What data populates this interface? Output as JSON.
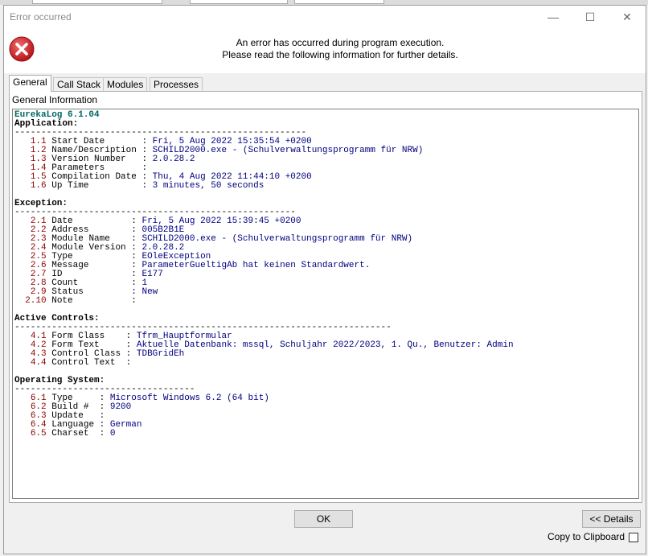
{
  "window": {
    "title": "Error occurred",
    "minimize_glyph": "—",
    "maximize_glyph": "☐",
    "close_glyph": "✕"
  },
  "header": {
    "line1": "An error has occurred during program execution.",
    "line2": "Please read the following information for further details.",
    "icon": "error-icon",
    "icon_color": "#d8262b"
  },
  "tabs": [
    "General",
    "Call Stack",
    "Modules",
    "Processes"
  ],
  "panel": {
    "title": "General Information"
  },
  "report": {
    "header": "EurekaLog 6.1.04",
    "sections": [
      {
        "title": "Application:",
        "rule": "-------------------------------------------------------",
        "rows": [
          {
            "n": "1.1",
            "label": "Start Date      ",
            "value": "Fri, 5 Aug 2022 15:35:54 +0200"
          },
          {
            "n": "1.2",
            "label": "Name/Description",
            "value": "SCHILD2000.exe - (Schulverwaltungsprogramm für NRW)"
          },
          {
            "n": "1.3",
            "label": "Version Number  ",
            "value": "2.0.28.2"
          },
          {
            "n": "1.4",
            "label": "Parameters      ",
            "value": ""
          },
          {
            "n": "1.5",
            "label": "Compilation Date",
            "value": "Thu, 4 Aug 2022 11:44:10 +0200"
          },
          {
            "n": "1.6",
            "label": "Up Time         ",
            "value": "3 minutes, 50 seconds"
          }
        ]
      },
      {
        "title": "Exception:",
        "rule": "-----------------------------------------------------",
        "rows": [
          {
            "n": "2.1",
            "label": "Date          ",
            "value": "Fri, 5 Aug 2022 15:39:45 +0200"
          },
          {
            "n": "2.2",
            "label": "Address       ",
            "value": "005B2B1E"
          },
          {
            "n": "2.3",
            "label": "Module Name   ",
            "value": "SCHILD2000.exe - (Schulverwaltungsprogramm für NRW)"
          },
          {
            "n": "2.4",
            "label": "Module Version",
            "value": "2.0.28.2"
          },
          {
            "n": "2.5",
            "label": "Type          ",
            "value": "EOleException"
          },
          {
            "n": "2.6",
            "label": "Message       ",
            "value": "ParameterGueltigAb hat keinen Standardwert."
          },
          {
            "n": "2.7",
            "label": "ID            ",
            "value": "E177"
          },
          {
            "n": "2.8",
            "label": "Count         ",
            "value": "1"
          },
          {
            "n": "2.9",
            "label": "Status        ",
            "value": "New"
          },
          {
            "n": "2.10",
            "label": "Note          ",
            "value": ""
          }
        ]
      },
      {
        "title": "Active Controls:",
        "rule": "-----------------------------------------------------------------------",
        "rows": [
          {
            "n": "4.1",
            "label": "Form Class   ",
            "value": "Tfrm_Hauptformular"
          },
          {
            "n": "4.2",
            "label": "Form Text    ",
            "value": "Aktuelle Datenbank: mssql, Schuljahr 2022/2023, 1. Qu., Benutzer: Admin"
          },
          {
            "n": "4.3",
            "label": "Control Class",
            "value": "TDBGridEh"
          },
          {
            "n": "4.4",
            "label": "Control Text ",
            "value": ""
          }
        ]
      },
      {
        "title": "Operating System:",
        "rule": "----------------------------------",
        "rows": [
          {
            "n": "6.1",
            "label": "Type    ",
            "value": "Microsoft Windows 6.2 (64 bit)"
          },
          {
            "n": "6.2",
            "label": "Build # ",
            "value": "9200"
          },
          {
            "n": "6.3",
            "label": "Update  ",
            "value": ""
          },
          {
            "n": "6.4",
            "label": "Language",
            "value": "German"
          },
          {
            "n": "6.5",
            "label": "Charset ",
            "value": "0"
          }
        ]
      }
    ]
  },
  "buttons": {
    "ok": "OK",
    "details": "<< Details"
  },
  "clipboard": {
    "label": "Copy to Clipboard",
    "checked": false
  }
}
